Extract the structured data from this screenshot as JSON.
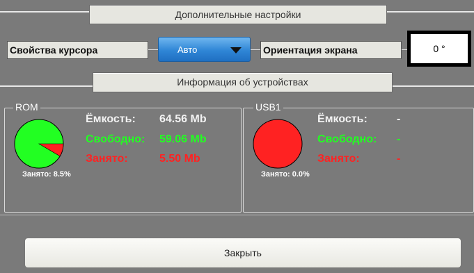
{
  "settings": {
    "title": "Дополнительные настройки",
    "cursor_label": "Свойства курсора",
    "cursor_value": "Авто",
    "orientation_label": "Ориентация экрана",
    "orientation_value": "0 °"
  },
  "devices_header": "Информация об устройствах",
  "devices": [
    {
      "name": "ROM",
      "capacity_label": "Ёмкость:",
      "capacity_value": "64.56 Mb",
      "free_label": "Свободно:",
      "free_value": "59.06 Mb",
      "used_label": "Занято:",
      "used_value": "5.50 Mb",
      "used_summary": "Занято: 8.5%",
      "used_fraction": 0.085
    },
    {
      "name": "USB1",
      "capacity_label": "Ёмкость:",
      "capacity_value": "-",
      "free_label": "Свободно:",
      "free_value": "-",
      "used_label": "Занято:",
      "used_value": "-",
      "used_summary": "Занято: 0.0%",
      "used_fraction": 0.0
    }
  ],
  "close_label": "Закрыть",
  "colors": {
    "free": "#22ff22",
    "used": "#ff2222",
    "accent": "#2f86d6"
  }
}
